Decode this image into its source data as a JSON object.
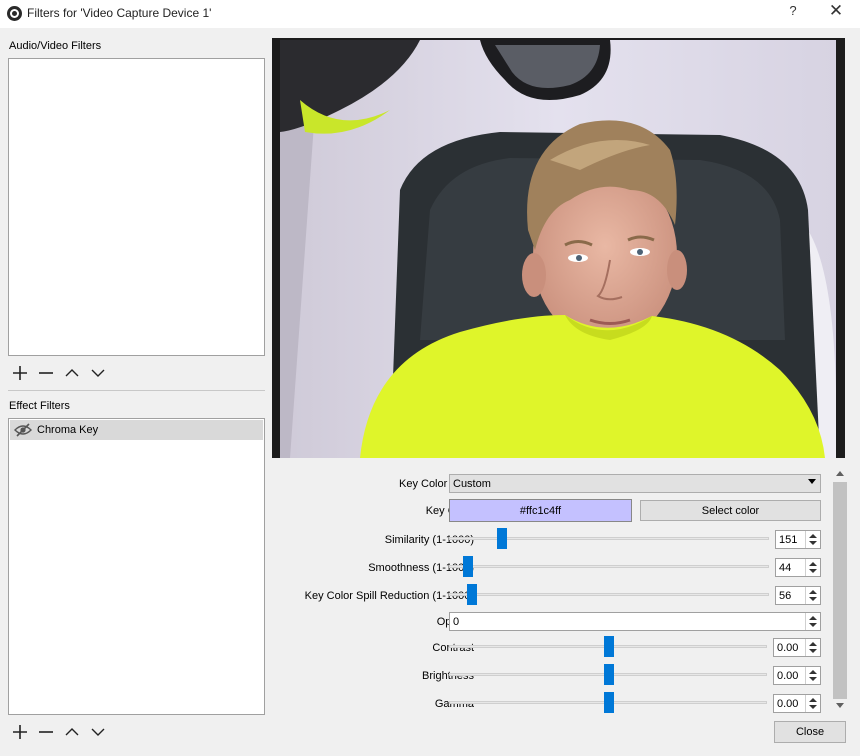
{
  "window": {
    "title": "Filters for 'Video Capture Device 1'",
    "help_glyph": "?",
    "close_glyph": "✕"
  },
  "audio_video_filters": {
    "label": "Audio/Video Filters",
    "items": []
  },
  "effect_filters": {
    "label": "Effect Filters",
    "items": [
      {
        "label": "Chroma Key",
        "icon": "eye-hidden-icon",
        "selected": true
      }
    ]
  },
  "toolbar": {
    "add_icon": "plus-icon",
    "remove_icon": "minus-icon",
    "up_icon": "chevron-up-icon",
    "down_icon": "chevron-down-icon"
  },
  "properties": {
    "key_color_type": {
      "label": "Key Color Type",
      "value": "Custom"
    },
    "key_color": {
      "label": "Key Color",
      "value": "#ffc1c4ff",
      "swatch": "#c4c1ff",
      "button": "Select color"
    },
    "similarity": {
      "label": "Similarity (1-1000)",
      "value": "151",
      "fraction": 0.15
    },
    "smoothness": {
      "label": "Smoothness (1-1000)",
      "value": "44",
      "fraction": 0.043
    },
    "spill": {
      "label": "Key Color Spill Reduction (1-1000)",
      "value": "56",
      "fraction": 0.055
    },
    "opacity": {
      "label": "Opacity",
      "value": "0"
    },
    "contrast": {
      "label": "Contrast",
      "value": "0.00",
      "fraction": 0.5
    },
    "brightness": {
      "label": "Brightness",
      "value": "0.00",
      "fraction": 0.5
    },
    "gamma": {
      "label": "Gamma",
      "value": "0.00",
      "fraction": 0.5
    }
  },
  "footer": {
    "close_label": "Close"
  },
  "colors": {
    "slider_handle": "#0078d7",
    "selection": "#d9d9d9",
    "shirt": "#dff52a"
  }
}
